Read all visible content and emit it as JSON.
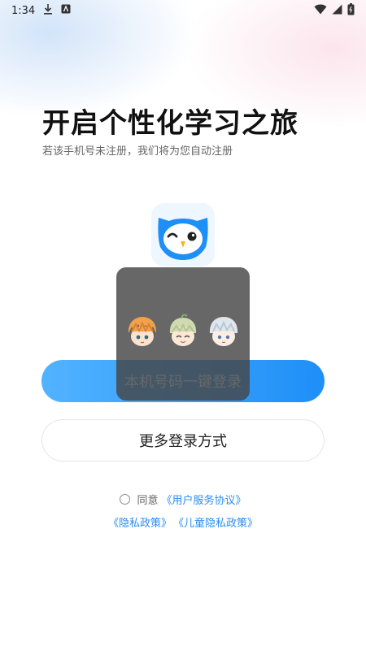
{
  "status_bar": {
    "time": "1:34",
    "icons": [
      "download-icon",
      "notification-a-icon",
      "wifi-icon",
      "cellular-icon",
      "battery-icon"
    ]
  },
  "header": {
    "title": "开启个性化学习之旅",
    "subtitle": "若该手机号未注册，我们将为您自动注册"
  },
  "logo": {
    "icon": "owl-logo-icon",
    "color": "#1e8ff7"
  },
  "buttons": {
    "one_click_login": "本机号码一键登录",
    "more_login": "更多登录方式"
  },
  "overlay": {
    "avatars": [
      "avatar-orange-hair",
      "avatar-green-hair",
      "avatar-silver-hair"
    ]
  },
  "agreement": {
    "prefix": "同意",
    "service_agreement": "《用户服务协议》",
    "privacy_policy": "《隐私政策》",
    "children_privacy": "《儿童隐私政策》"
  },
  "colors": {
    "accent": "#1e8ff7",
    "link": "#2a8cf0"
  }
}
